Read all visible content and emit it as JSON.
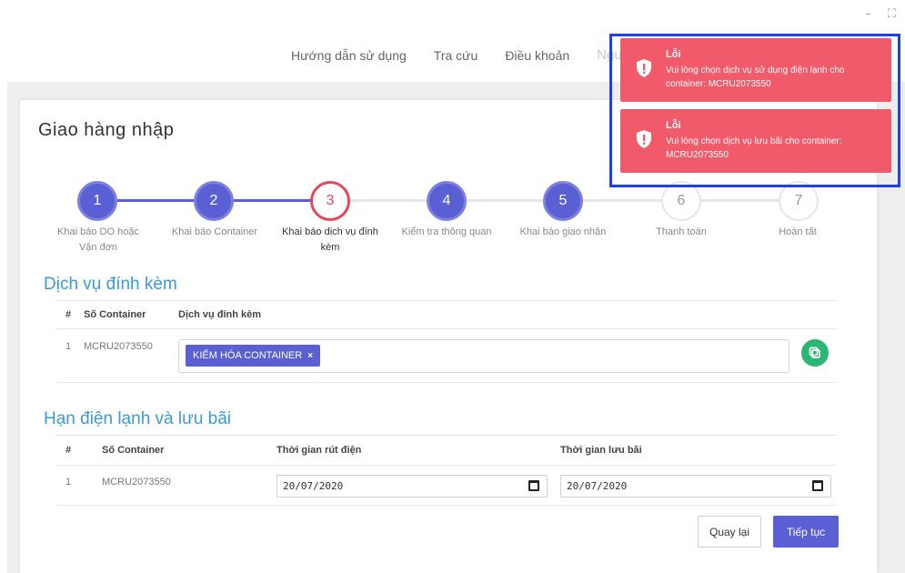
{
  "window": {
    "minimize_glyph": "–",
    "maximize_glyph": "⛶"
  },
  "topnav": {
    "items": [
      "Hướng dẫn sử dụng",
      "Tra cứu",
      "Điều khoản"
    ],
    "user_name": "Nguyễn Văn Nhàn"
  },
  "page": {
    "title": "Giao hàng nhập",
    "card_minimize": "–",
    "card_expand": "⛶"
  },
  "stepper": {
    "steps": [
      {
        "number": "1",
        "label_line1": "Khai báo DO hoặc",
        "label_line2": "Vận đơn",
        "state": "done"
      },
      {
        "number": "2",
        "label_line1": "Khai báo Container",
        "label_line2": "",
        "state": "done"
      },
      {
        "number": "3",
        "label_line1": "Khai báo dịch vụ đính",
        "label_line2": "kèm",
        "state": "current"
      },
      {
        "number": "4",
        "label_line1": "Kiểm tra thông quan",
        "label_line2": "",
        "state": "done"
      },
      {
        "number": "5",
        "label_line1": "Khai báo giao nhận",
        "label_line2": "",
        "state": "done"
      },
      {
        "number": "6",
        "label_line1": "Thanh toán",
        "label_line2": "",
        "state": "todo"
      },
      {
        "number": "7",
        "label_line1": "Hoàn tất",
        "label_line2": "",
        "state": "todo"
      }
    ]
  },
  "attached_services": {
    "section_title": "Dịch vụ đính kèm",
    "headers": {
      "index": "#",
      "container": "Số Container",
      "service": "Dịch vụ đính kèm"
    },
    "rows": [
      {
        "index": "1",
        "container": "MCRU2073550",
        "tags": [
          "KIỂM HÓA CONTAINER"
        ]
      }
    ],
    "tag_remove_glyph": "×"
  },
  "cold_storage": {
    "section_title": "Hạn điện lạnh và lưu bãi",
    "headers": {
      "index": "#",
      "container": "Số Container",
      "unplug_time": "Thời gian rút điện",
      "storage_time": "Thời gian lưu bãi"
    },
    "rows": [
      {
        "index": "1",
        "container": "MCRU2073550",
        "unplug_date": "20/07/2020",
        "storage_date": "20/07/2020"
      }
    ]
  },
  "actions": {
    "back": "Quay lại",
    "next": "Tiếp tục"
  },
  "toasts": [
    {
      "title": "Lỗi",
      "message": "Vui lòng chọn dịch vụ sử dụng điện lạnh cho container: MCRU2073550"
    },
    {
      "title": "Lỗi",
      "message": "Vui lòng chọn dịch vụ lưu bãi cho container: MCRU2073550"
    }
  ],
  "colors": {
    "primary": "#5b5fd4",
    "current_step": "#e8475b",
    "section_title": "#3a9ad9",
    "toast_bg": "#f05a6b",
    "highlight_outline": "#1c3ff0",
    "copy_button": "#2bb673"
  }
}
